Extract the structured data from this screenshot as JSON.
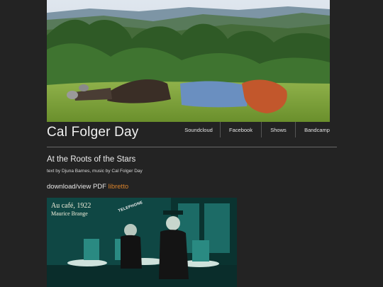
{
  "site": {
    "title": "Cal Folger Day"
  },
  "nav": [
    "Soundcloud",
    "Facebook",
    "Shows",
    "Bandcamp"
  ],
  "post": {
    "title": "At the Roots of the Stars",
    "credits": "text by Djuna Barnes, music by Cal Folger Day",
    "download_prefix": "download/view PDF ",
    "download_link": "libretto"
  },
  "photo": {
    "caption_line1": "Au café, 1922",
    "caption_line2": "Maurice Brange",
    "sign": "TELEPHONE"
  },
  "colors": {
    "background": "#232323",
    "link": "#d9822b",
    "text": "#eaeaea"
  }
}
